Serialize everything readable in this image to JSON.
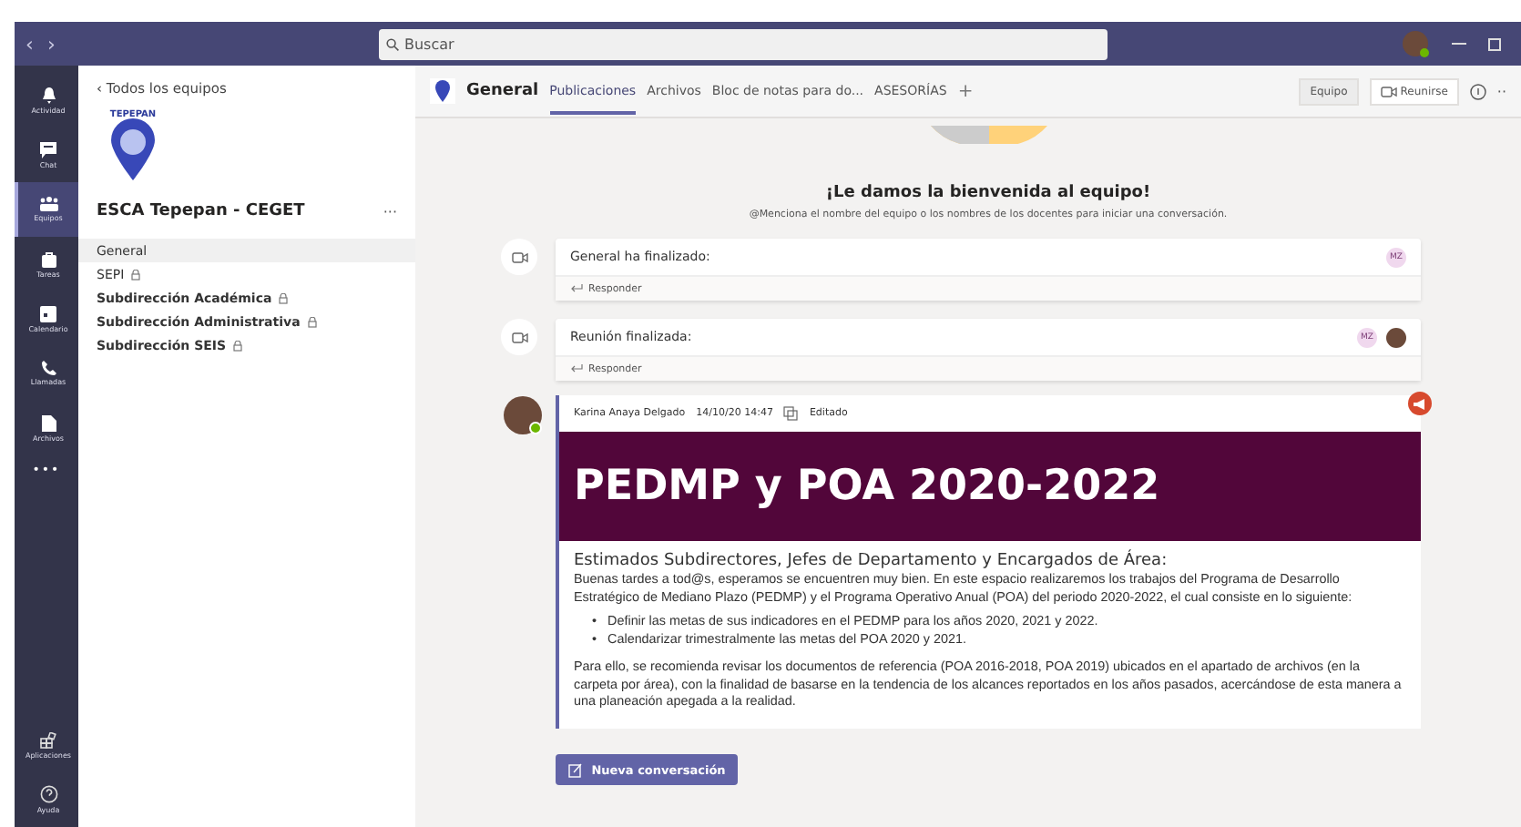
{
  "title_bar": {
    "nav": [
      "‹",
      "›"
    ],
    "search": {
      "placeholder": "Buscar"
    }
  },
  "rail": [
    {
      "label": "Actividad",
      "kind": "bell",
      "selected": false
    },
    {
      "label": "Chat",
      "kind": "chat",
      "selected": false
    },
    {
      "label": "Equipos",
      "kind": "teams",
      "selected": true
    },
    {
      "label": "Tareas",
      "kind": "bag",
      "selected": false
    },
    {
      "label": "Calendario",
      "kind": "calendar",
      "selected": false
    },
    {
      "label": "Llamadas",
      "kind": "phone",
      "selected": false
    },
    {
      "label": "Archivos",
      "kind": "file",
      "selected": false
    }
  ],
  "rail_more": "•••",
  "rail_bottom": [
    {
      "label": "Aplicaciones",
      "kind": "apps"
    },
    {
      "label": "Ayuda",
      "kind": "help"
    }
  ],
  "team_panel": {
    "back_arrow": "‹",
    "back": "Todos los equipos",
    "logo_text": "TEPEPAN",
    "team_name": "ESCA Tepepan - CEGET",
    "more": "···",
    "channels": [
      {
        "name": "General",
        "selected": true,
        "private": false,
        "unread": false
      },
      {
        "name": "SEPI",
        "selected": false,
        "private": true,
        "unread": false
      },
      {
        "name": "Subdirección Académica",
        "selected": false,
        "private": true,
        "unread": true
      },
      {
        "name": "Subdirección Administrativa",
        "selected": false,
        "private": true,
        "unread": true
      },
      {
        "name": "Subdirección SEIS",
        "selected": false,
        "private": true,
        "unread": true
      }
    ]
  },
  "channel_header": {
    "name": "General",
    "tabs": [
      {
        "label": "Publicaciones",
        "selected": true
      },
      {
        "label": "Archivos",
        "selected": false
      },
      {
        "label": "Bloc de notas para do...",
        "selected": false
      },
      {
        "label": "ASESORÍAS",
        "selected": false
      }
    ],
    "add": "+",
    "team_button": "Equipo",
    "meet_button": "Reunirse",
    "more": "··"
  },
  "welcome": {
    "title": "¡Le damos la bienvenida al equipo!",
    "hint": "@Menciona el nombre del equipo o los nombres de los docentes para iniciar una conversación."
  },
  "meetings": [
    {
      "text": "General ha finalizado:",
      "reply": "Responder",
      "participants": [
        {
          "kind": "initials",
          "initials": "MZ"
        }
      ]
    },
    {
      "text": "Reunión finalizada:",
      "reply": "Responder",
      "participants": [
        {
          "kind": "initials",
          "initials": "MZ"
        },
        {
          "kind": "photo"
        }
      ]
    }
  ],
  "post": {
    "author": "Karina Anaya Delgado",
    "time": "14/10/20 14:47",
    "edited": "Editado",
    "important": true,
    "banner": "PEDMP y POA 2020-2022",
    "heading": "Estimados Subdirectores, Jefes de Departamento y Encargados de Área:",
    "intro": "Buenas tardes a tod@s, esperamos se encuentren muy bien. En este espacio realizaremos los trabajos del Programa de Desarrollo Estratégico de Mediano Plazo (PEDMP) y el Programa Operativo Anual (POA) del periodo 2020-2022, el cual consiste en lo siguiente:",
    "bullet_marker": "•",
    "bullets": [
      "Definir las metas de sus indicadores en el PEDMP para los años 2020, 2021 y 2022.",
      "Calendarizar trimestralmente las metas del POA 2020 y 2021."
    ],
    "closing": "Para ello, se recomienda revisar los documentos de referencia (POA 2016-2018, POA 2019) ubicados en el apartado de archivos (en la carpeta por área), con la finalidad de basarse en la tendencia de los alcances reportados en los años pasados, acercándose de esta manera a una planeación apegada a la realidad."
  },
  "new_conversation": "Nueva conversación"
}
